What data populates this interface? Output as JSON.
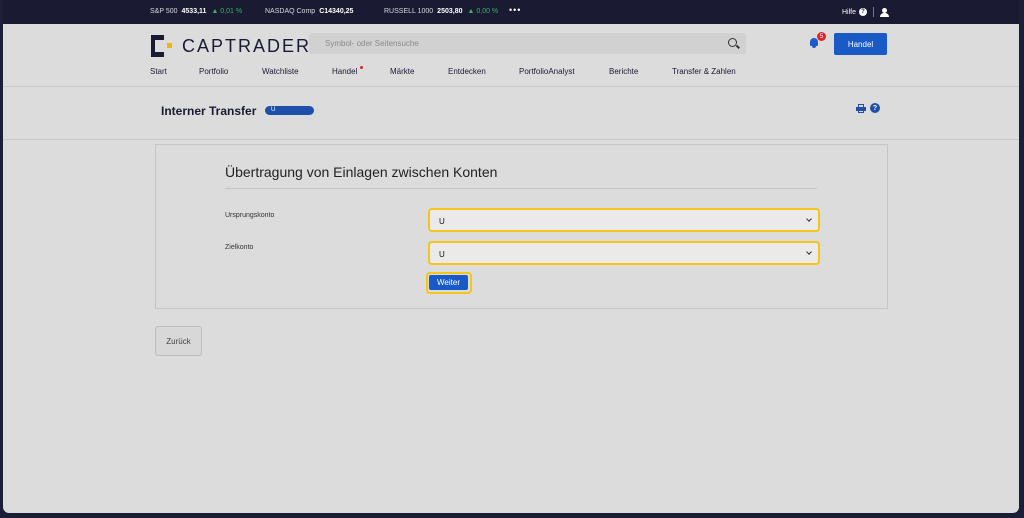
{
  "ticker": {
    "items": [
      {
        "name": "S&P 500",
        "value": "4533,11",
        "change": "▲ 0,01 %"
      },
      {
        "name": "NASDAQ Comp",
        "value": "C14340,25",
        "change": ""
      },
      {
        "name": "RUSSELL 1000",
        "value": "2503,80",
        "change": "▲ 0,00 %"
      }
    ],
    "more": "•••",
    "help_label": "Hilfe",
    "help_glyph": "?"
  },
  "header": {
    "brand": "CAPTRADER",
    "search_placeholder": "Symbol- oder Seitensuche",
    "notification_count": "5",
    "trade_button": "Handel"
  },
  "nav": {
    "items": [
      "Start",
      "Portfolio",
      "Watchliste",
      "Handel",
      "Märkte",
      "Entdecken",
      "PortfolioAnalyst",
      "Berichte",
      "Transfer & Zahlen"
    ]
  },
  "page": {
    "title": "Interner Transfer",
    "account_pill": "U",
    "help_glyph": "?"
  },
  "form": {
    "heading": "Übertragung von Einlagen zwischen Konten",
    "source_label": "Ursprungskonto",
    "source_value": "U",
    "target_label": "Zielkonto",
    "target_value": "U",
    "next_button": "Weiter"
  },
  "back_button": "Zurück",
  "colors": {
    "accent": "#1a5ac6",
    "highlight": "#f5c518",
    "dark": "#1a1b33",
    "positive": "#34b46a",
    "alert": "#e0242c"
  }
}
